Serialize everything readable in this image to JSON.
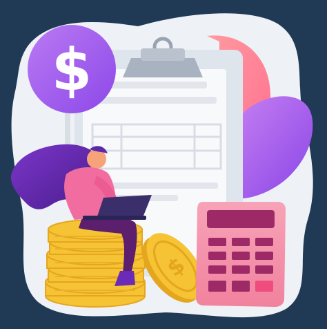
{
  "illustration": {
    "dollar_badge": {
      "symbol": "$",
      "icon": "dollar-sign-icon"
    },
    "clipboard": {
      "icon": "clipboard-icon"
    },
    "calculator": {
      "icon": "calculator-icon"
    },
    "person": {
      "icon": "woman-with-laptop-icon"
    },
    "coins": {
      "icon": "coin-stack-icon"
    }
  },
  "colors": {
    "background": "#203a56",
    "blob": "#eef1f5",
    "badge": "#a45ef0",
    "calculator": "#f48fa8",
    "coin": "#f6c334",
    "hair": "#6b2ab8",
    "sweater": "#f26d9f",
    "laptop": "#3b2f6b"
  }
}
